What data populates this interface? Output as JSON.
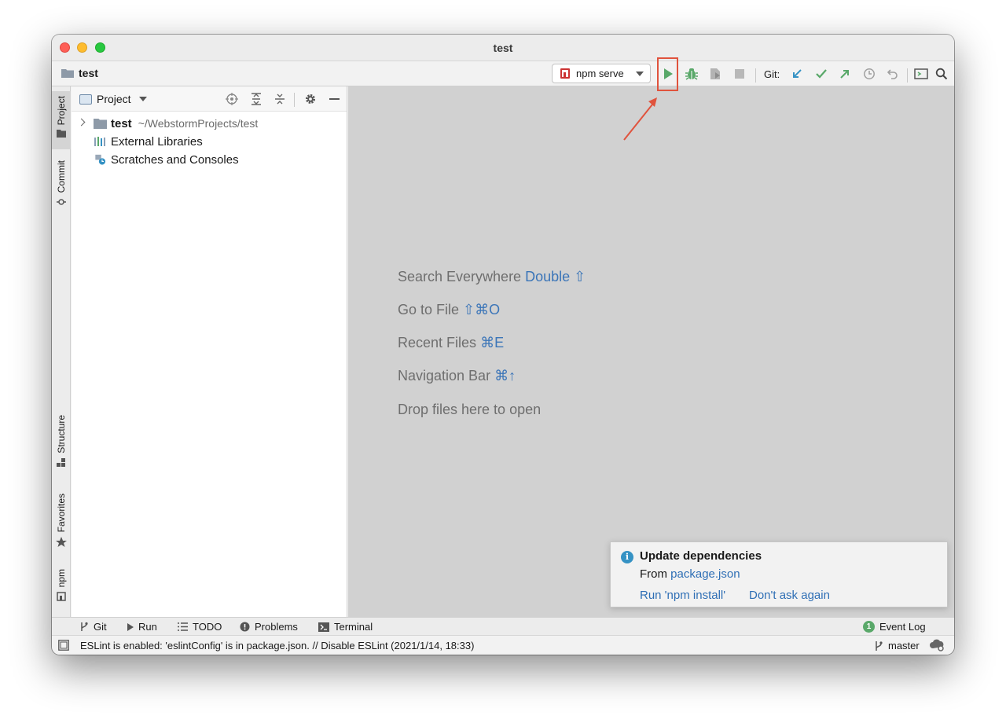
{
  "window": {
    "title": "test"
  },
  "toolbar": {
    "breadcrumb": "test",
    "run_config": "npm serve",
    "git_label": "Git:"
  },
  "left_strip": {
    "tabs": [
      {
        "label": "Project",
        "icon": "folder-icon"
      },
      {
        "label": "Commit",
        "icon": "commit-icon"
      },
      {
        "label": "Structure",
        "icon": "structure-icon"
      },
      {
        "label": "Favorites",
        "icon": "star-icon"
      },
      {
        "label": "npm",
        "icon": "npm-icon"
      }
    ]
  },
  "project_panel": {
    "title": "Project",
    "tree": [
      {
        "label": "test",
        "path": "~/WebstormProjects/test",
        "icon": "folder-icon"
      },
      {
        "label": "External Libraries",
        "icon": "library-icon"
      },
      {
        "label": "Scratches and Consoles",
        "icon": "scratches-icon"
      }
    ]
  },
  "editor": {
    "hints": [
      {
        "text": "Search Everywhere",
        "key": "Double ⇧"
      },
      {
        "text": "Go to File",
        "key": "⇧⌘O"
      },
      {
        "text": "Recent Files",
        "key": "⌘E"
      },
      {
        "text": "Navigation Bar",
        "key": "⌘↑"
      },
      {
        "text": "Drop files here to open",
        "key": ""
      }
    ]
  },
  "notification": {
    "title": "Update dependencies",
    "body_prefix": "From",
    "body_link": "package.json",
    "actions": [
      "Run 'npm install'",
      "Don't ask again"
    ]
  },
  "bottom_tabs": [
    {
      "label": "Git",
      "icon": "git-branch-icon"
    },
    {
      "label": "Run",
      "icon": "run-icon"
    },
    {
      "label": "TODO",
      "icon": "todo-icon"
    },
    {
      "label": "Problems",
      "icon": "problems-icon"
    },
    {
      "label": "Terminal",
      "icon": "terminal-icon"
    }
  ],
  "event_log": {
    "count": "1",
    "label": "Event Log"
  },
  "status": {
    "message": "ESLint is enabled: 'eslintConfig' is in package.json. // Disable ESLint (2021/1/14, 18:33)",
    "branch": "master"
  },
  "colors": {
    "run_green": "#59a869",
    "link_blue": "#2f6fb5",
    "highlight_red": "#e0533d",
    "editor_bg": "#d1d1d1"
  }
}
